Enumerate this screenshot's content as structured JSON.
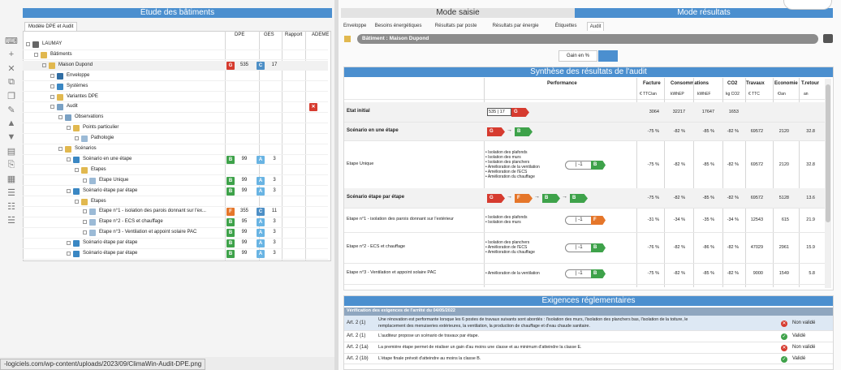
{
  "left": {
    "title": "Étude des bâtiments",
    "tab": "Modèle DPE et Audit"
  },
  "colors": {
    "accent": "#4b8fcf",
    "G": "#d63b2f",
    "F": "#e5762a",
    "C": "#4d8fc6",
    "A": "#69b4e3",
    "B": "#3ea24a"
  },
  "toolbar": [
    "keyboard-icon",
    "add-icon",
    "delete-icon",
    "duplicate-icon",
    "copy-icon",
    "edit-icon",
    "up-icon",
    "down-icon",
    "document-icon",
    "paste-icon",
    "clipboard-icon",
    "list-add-icon",
    "list-icon",
    "list-user-icon"
  ],
  "tree_headers": {
    "dpe": "DPE",
    "ges": "GES",
    "rapport": "Rapport",
    "ademe": "ADEME"
  },
  "tree": [
    {
      "label": "LAUMAY",
      "indent": 0,
      "icon": "#666"
    },
    {
      "label": "Bâtiments",
      "indent": 1,
      "icon": "#e1b84f"
    },
    {
      "label": "Maison Dupond",
      "indent": 2,
      "icon": "#e1b84f",
      "dpe": "G",
      "dpe_v": "535",
      "ges": "C",
      "ges_v": "17",
      "highlight": true
    },
    {
      "label": "Enveloppe",
      "indent": 3,
      "icon": "#2f6da3"
    },
    {
      "label": "Systèmes",
      "indent": 3,
      "icon": "#3a87c3"
    },
    {
      "label": "Variantes DPE",
      "indent": 3,
      "icon": "#e1b84f"
    },
    {
      "label": "Audit",
      "indent": 3,
      "icon": "#7aa1c4",
      "ademe": "x"
    },
    {
      "label": "Observations",
      "indent": 4,
      "icon": "#7aa1c4"
    },
    {
      "label": "Points particulier",
      "indent": 5,
      "icon": "#e1b84f"
    },
    {
      "label": "Pathologie",
      "indent": 6,
      "icon": "#9bbad6"
    },
    {
      "label": "Scénarios",
      "indent": 4,
      "icon": "#e1b84f"
    },
    {
      "label": "Scénario en une étape",
      "indent": 5,
      "icon": "#3a87c3",
      "dpe": "B",
      "dpe_v": "99",
      "ges": "A",
      "ges_v": "3"
    },
    {
      "label": "Etapes",
      "indent": 6,
      "icon": "#e1b84f"
    },
    {
      "label": "Etape Unique",
      "indent": 7,
      "icon": "#9bbad6",
      "dpe": "B",
      "dpe_v": "99",
      "ges": "A",
      "ges_v": "3"
    },
    {
      "label": "Scénario étape par étape",
      "indent": 5,
      "icon": "#3a87c3",
      "dpe": "B",
      "dpe_v": "99",
      "ges": "A",
      "ges_v": "3"
    },
    {
      "label": "Etapes",
      "indent": 6,
      "icon": "#e1b84f"
    },
    {
      "label": "Etape n°1 - isolation des parois donnant sur l'ex...",
      "indent": 7,
      "icon": "#9bbad6",
      "dpe": "F",
      "dpe_v": "355",
      "ges": "C",
      "ges_v": "11"
    },
    {
      "label": "Etape n°2 - ECS et chauffage",
      "indent": 7,
      "icon": "#9bbad6",
      "dpe": "B",
      "dpe_v": "95",
      "ges": "A",
      "ges_v": "3"
    },
    {
      "label": "Etape n°3 - Ventilation et appoint solaire PAC",
      "indent": 7,
      "icon": "#9bbad6",
      "dpe": "B",
      "dpe_v": "99",
      "ges": "A",
      "ges_v": "3"
    },
    {
      "label": "Scénario étape par étape",
      "indent": 5,
      "icon": "#3a87c3",
      "dpe": "B",
      "dpe_v": "99",
      "ges": "A",
      "ges_v": "3"
    },
    {
      "label": "Scénario étape par étape",
      "indent": 5,
      "icon": "#3a87c3",
      "dpe": "B",
      "dpe_v": "99",
      "ges": "A",
      "ges_v": "3"
    }
  ],
  "right": {
    "mode_saisie": "Mode saisie",
    "mode_resultats": "Mode résultats",
    "tabs": [
      "Enveloppe",
      "Besoins énergétiques",
      "Résultats par poste",
      "Résultats par énergie",
      "Étiquettes",
      "Audit"
    ],
    "building": "Bâtiment : Maison Dupond",
    "gain_label": "Gain en %",
    "synthese_title": "Synthèse des résultats de l'audit",
    "col_perf": "Performance",
    "col_facture": "Facture",
    "col_conso": "Consommations",
    "col_co2": "CO2",
    "col_travaux": "Travaux",
    "col_economie": "Economie",
    "col_retour": "T.retour",
    "units": [
      "€ TTC/an",
      "kWhEP",
      "kWhEF",
      "kg CO2",
      "€ TTC",
      "€/an",
      "an"
    ],
    "rows": [
      {
        "label": "Etat initial",
        "bold": true,
        "perf": "535 | 17",
        "facture": "3064",
        "cep": "32217",
        "cef": "17647",
        "co2": "1653",
        "travaux": "",
        "eco": "",
        "ret": ""
      },
      {
        "label": "Scénario en une étape",
        "bold": true,
        "facture": "-75 %",
        "cep": "-82 %",
        "cef": "-85 %",
        "co2": "-82 %",
        "travaux": "69572",
        "eco": "2120",
        "ret": "32.8"
      },
      {
        "label": "Etape Unique",
        "bullets": [
          "Isolation des plafonds",
          "Isolation des murs",
          "Isolation des planchers",
          "Amélioration de la ventilation",
          "Amélioration de l'ECS",
          "Amélioration du chauffage"
        ],
        "gain": "| -1",
        "gain_cls": "B",
        "facture": "-75 %",
        "cep": "-82 %",
        "cef": "-85 %",
        "co2": "-82 %",
        "travaux": "69572",
        "eco": "2120",
        "ret": "32.8"
      },
      {
        "label": "Scénario étape par étape",
        "bold": true,
        "facture": "-75 %",
        "cep": "-82 %",
        "cef": "-85 %",
        "co2": "-82 %",
        "travaux": "69572",
        "eco": "5128",
        "ret": "13.6"
      },
      {
        "label": "Etape n°1 - isolation des parois donnant sur l'extérieur",
        "bullets": [
          "Isolation des plafonds",
          "Isolation des murs"
        ],
        "gain": "| -1",
        "gain_cls": "F",
        "facture": "-31 %",
        "cep": "-34 %",
        "cef": "-35 %",
        "co2": "-34 %",
        "travaux": "12543",
        "eco": "615",
        "ret": "21.9"
      },
      {
        "label": "Etape n°2 - ECS et chauffage",
        "bullets": [
          "Isolation des planchers",
          "Amélioration de l'ECS",
          "Amélioration du chauffage"
        ],
        "gain": "| -1",
        "gain_cls": "B",
        "facture": "-76 %",
        "cep": "-82 %",
        "cef": "-86 %",
        "co2": "-82 %",
        "travaux": "47029",
        "eco": "2961",
        "ret": "15.9"
      },
      {
        "label": "Etape n°3 - Ventilation et appoint solaire PAC",
        "bullets": [
          "Amélioration de la ventilation"
        ],
        "gain": "| -1",
        "gain_cls": "B",
        "facture": "-75 %",
        "cep": "-82 %",
        "cef": "-85 %",
        "co2": "-82 %",
        "travaux": "9000",
        "eco": "1549",
        "ret": "5.8"
      }
    ],
    "exigences_title": "Exigences réglementaires",
    "verif": "Vérification des exigences de l'arrêté du 04/05/2022",
    "exigences": [
      {
        "art": "Art. 2 (1)",
        "text1": "Une rénovation est performante lorsque les 6 postes de travaux suivants sont abordés : l'isolation des murs, l'isolation des planchers bas, l'isolation de la toiture, le",
        "text2": "remplacement des menuiseries extérieures, la ventilation, la production de chauffage et d'eau chaude sanitaire.",
        "status": "Non validé",
        "ok": false
      },
      {
        "art": "Art. 2 (1)",
        "text1": "L'auditeur propose un scénario de travaux par étape.",
        "text2": "",
        "status": "Validé",
        "ok": true
      },
      {
        "art": "Art. 2 (1a)",
        "text1": "La première étape permet de réaliser un gain d'au moins une classe et au minimum d'atteindre la classe E.",
        "text2": "",
        "status": "Non validé",
        "ok": false
      },
      {
        "art": "Art. 2 (1b)",
        "text1": "L'étape finale prévoit d'atteindre au moins la classe B.",
        "text2": "",
        "status": "Validé",
        "ok": true
      }
    ]
  },
  "url_tooltip": "-logiciels.com/wp-content/uploads/2023/09/ClimaWin-Audit-DPE.png"
}
